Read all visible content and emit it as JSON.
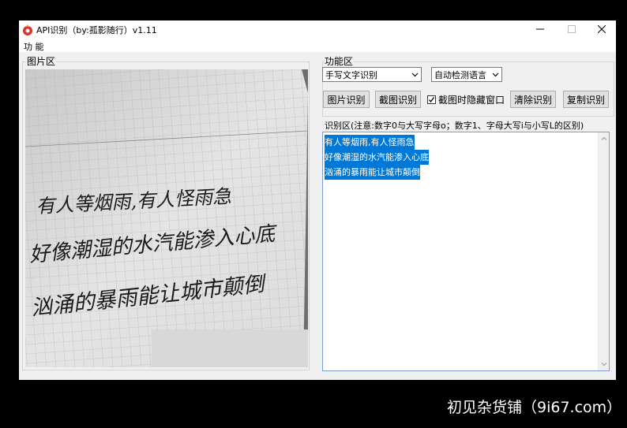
{
  "window": {
    "title": "API识别（by:孤影随行）v1.11"
  },
  "menu": {
    "items": [
      "功 能"
    ]
  },
  "image_panel": {
    "label": "图片区",
    "handwriting_lines": [
      "有人等烟雨,有人怪雨急",
      "好像潮湿的水汽能渗入心底",
      "汹涌的暴雨能让城市颠倒"
    ]
  },
  "function_panel": {
    "label": "功能区",
    "mode_select_value": "手写文字识别",
    "language_select_value": "自动检测语言",
    "buttons": {
      "image_recognize": "图片识别",
      "screenshot_recognize": "截图识别",
      "clear_recognize": "清除识别",
      "copy_recognize": "复制识别"
    },
    "hide_window_checkbox": {
      "label": "截图时隐藏窗口",
      "checked": true
    }
  },
  "result_panel": {
    "label": "识别区(注意:数字0与大写字母o；数字1、字母大写i与小写L的区别)",
    "lines": [
      "有人等烟雨,有人怪雨急",
      "好像潮湿的水汽能渗入心底",
      "汹涌的暴雨能让城市颠倒"
    ]
  },
  "watermark": "初见杂货铺（9i67.com）",
  "colors": {
    "selection": "#0078d7",
    "window_bg": "#f0f0f0",
    "title_icon": "#d9352b"
  }
}
